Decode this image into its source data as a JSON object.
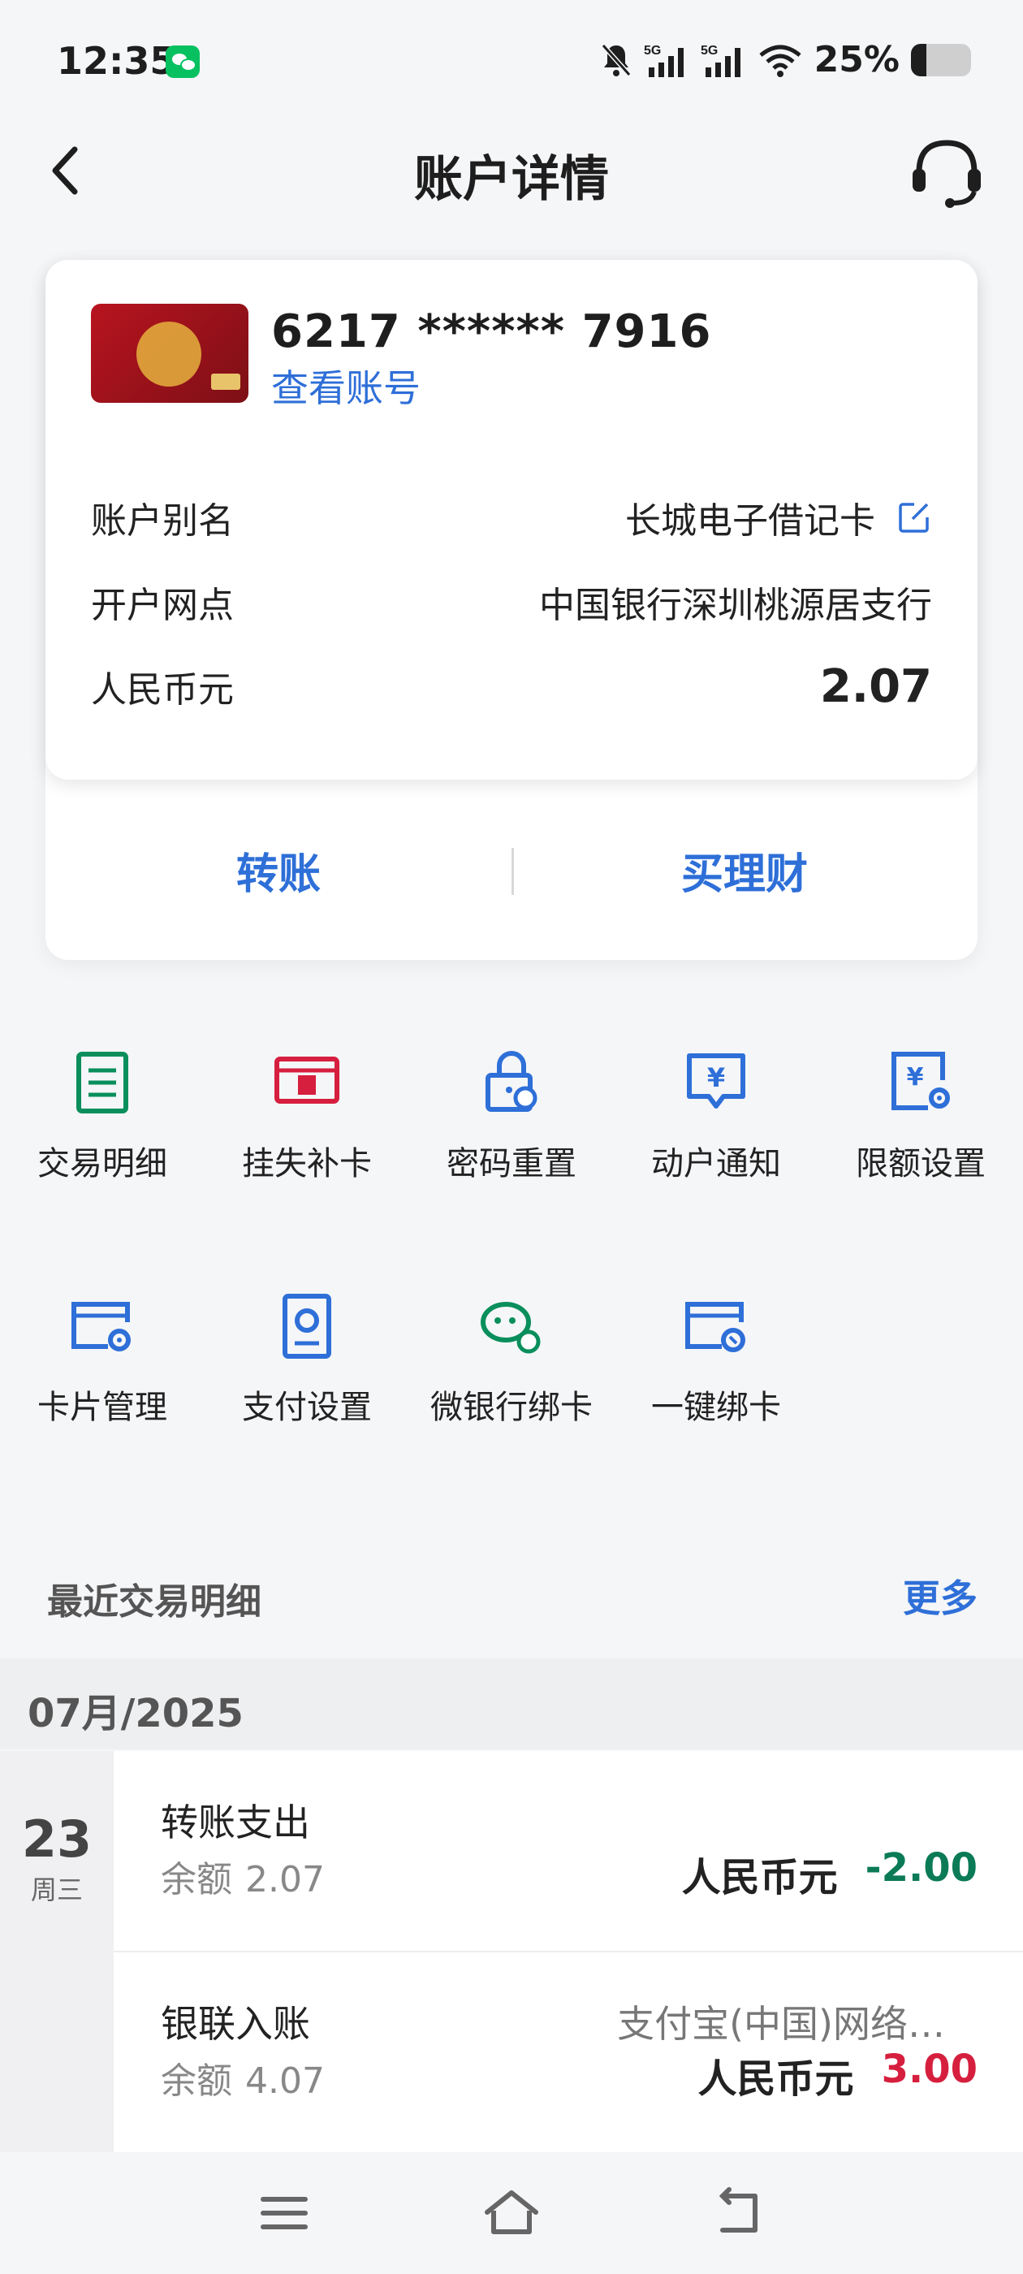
{
  "status_bar": {
    "time": "12:35",
    "battery_text": "25%",
    "network_1": "5G",
    "network_2": "5G"
  },
  "header": {
    "title": "账户详情"
  },
  "account_card": {
    "card_number": "6217 ****** 7916",
    "view_account_link": "查看账号",
    "rows": [
      {
        "label": "账户别名",
        "value": "长城电子借记卡"
      },
      {
        "label": "开户网点",
        "value": "中国银行深圳桃源居支行"
      },
      {
        "label": "人民币元",
        "value": "2.07"
      }
    ],
    "actions": [
      {
        "label": "转账"
      },
      {
        "label": "买理财"
      }
    ]
  },
  "grid": [
    {
      "label": "交易明细",
      "icon": "transaction-detail-icon",
      "color": "#0a8f5c"
    },
    {
      "label": "挂失补卡",
      "icon": "report-loss-icon",
      "color": "#d61f3e"
    },
    {
      "label": "密码重置",
      "icon": "password-reset-icon",
      "color": "#2e6fd8"
    },
    {
      "label": "动户通知",
      "icon": "account-notice-icon",
      "color": "#2e6fd8"
    },
    {
      "label": "限额设置",
      "icon": "limit-settings-icon",
      "color": "#2e6fd8"
    },
    {
      "label": "卡片管理",
      "icon": "card-management-icon",
      "color": "#2e6fd8"
    },
    {
      "label": "支付设置",
      "icon": "payment-settings-icon",
      "color": "#2e6fd8"
    },
    {
      "label": "微银行绑卡",
      "icon": "wechat-bind-icon",
      "color": "#0a8f5c"
    },
    {
      "label": "一键绑卡",
      "icon": "one-click-bind-icon",
      "color": "#2e6fd8"
    }
  ],
  "recent": {
    "title": "最近交易明细",
    "more": "更多",
    "month": "07月/2025",
    "day": "23",
    "weekday": "周三",
    "balance_label": "余额",
    "transactions": [
      {
        "title": "转账支出",
        "balance": "2.07",
        "currency": "人民币元",
        "amount": "-2.00",
        "counterparty": ""
      },
      {
        "title": "银联入账",
        "balance": "4.07",
        "currency": "人民币元",
        "amount": "3.00",
        "counterparty": "支付宝(中国)网络…"
      }
    ]
  },
  "colors": {
    "accent": "#2e6fd8",
    "negative": "#0b7a57",
    "positive": "#d61f3e"
  }
}
